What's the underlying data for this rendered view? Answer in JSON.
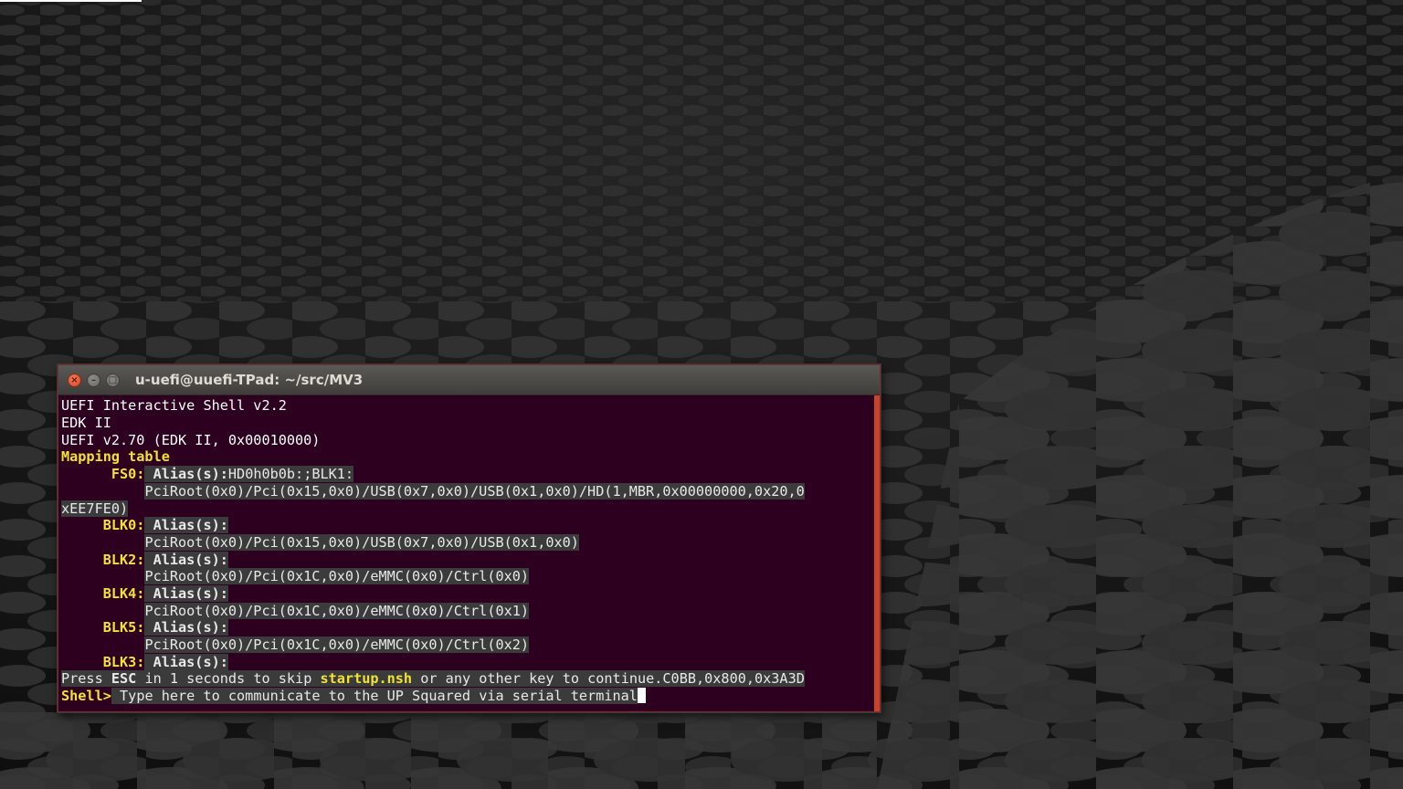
{
  "window": {
    "title": "u-uefi@uuefi-TPad: ~/src/MV3",
    "close_glyph": "×",
    "minimize_glyph": "–",
    "maximize_glyph": "□"
  },
  "terminal": {
    "line1": "UEFI Interactive Shell v2.2",
    "line2": "EDK II",
    "line3": "UEFI v2.70 (EDK II, 0x00010000)",
    "mapping_table": "Mapping table",
    "fs0_label": "FS0:",
    "fs0_alias_label": "Alias(s):",
    "fs0_alias_value": "HD0h0b0b:;BLK1:",
    "fs0_path_1": "PciRoot(0x0)/Pci(0x15,0x0)/USB(0x7,0x0)/USB(0x1,0x0)/HD(1,MBR,0x00000000,0x20,0",
    "fs0_path_2": "xEE7FE0)",
    "blk0_label": "BLK0:",
    "blk0_alias_label": "Alias(s):",
    "blk0_path": "PciRoot(0x0)/Pci(0x15,0x0)/USB(0x7,0x0)/USB(0x1,0x0)",
    "blk2_label": "BLK2:",
    "blk2_alias_label": "Alias(s):",
    "blk2_path": "PciRoot(0x0)/Pci(0x1C,0x0)/eMMC(0x0)/Ctrl(0x0)",
    "blk4_label": "BLK4:",
    "blk4_alias_label": "Alias(s):",
    "blk4_path": "PciRoot(0x0)/Pci(0x1C,0x0)/eMMC(0x0)/Ctrl(0x1)",
    "blk5_label": "BLK5:",
    "blk5_alias_label": "Alias(s):",
    "blk5_path": "PciRoot(0x0)/Pci(0x1C,0x0)/eMMC(0x0)/Ctrl(0x2)",
    "blk3_label": "BLK3:",
    "blk3_alias_label": "Alias(s):",
    "press_prefix": "Press",
    "press_key": "ESC",
    "press_mid": "in 1 seconds to skip",
    "press_script": "startup.nsh",
    "press_suffix": "or any other key to continue.C0BB,0x800,0x3A3D",
    "prompt": "Shell>",
    "input_text": "Type here to communicate to the UP Squared via serial terminal"
  },
  "colors": {
    "terminal_background": "#2c001e",
    "highlight_text": "#f2e232",
    "selection_background": "#3b3b3b",
    "close_button": "#e25a3a",
    "scroll_edge": "#c8432a"
  },
  "icons": {
    "close": "close-icon",
    "minimize": "minimize-icon",
    "maximize": "maximize-icon",
    "cursor": "text-cursor"
  }
}
